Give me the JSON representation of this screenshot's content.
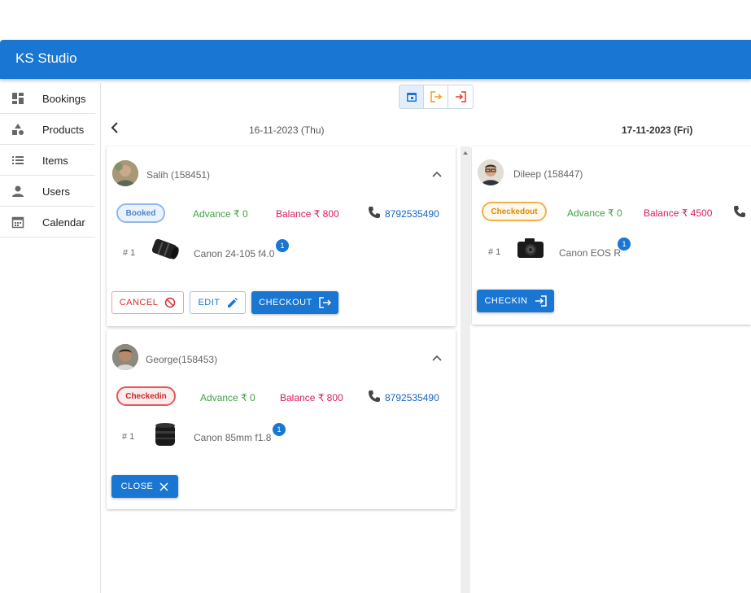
{
  "app": {
    "title": "KS Studio",
    "accent": "#1976d2"
  },
  "sidebar": {
    "items": [
      {
        "label": "Bookings",
        "icon": "dashboard-icon"
      },
      {
        "label": "Products",
        "icon": "category-icon"
      },
      {
        "label": "Items",
        "icon": "list-icon"
      },
      {
        "label": "Users",
        "icon": "person-icon"
      },
      {
        "label": "Calendar",
        "icon": "calendar-icon"
      }
    ]
  },
  "view_toggle": [
    "calendar-icon",
    "logout-icon",
    "login-icon"
  ],
  "dates": [
    "16-11-2023 (Thu)",
    "17-11-2023 (Fri)"
  ],
  "bookings": [
    {
      "customer": "Salih (158451)",
      "status": "Booked",
      "advance": "Advance ₹ 0",
      "balance": "Balance ₹ 800",
      "phone": "8792535490",
      "index": "# 1",
      "product": "Canon 24-105 f4.0",
      "qty": "1",
      "buttons": {
        "cancel": "CANCEL",
        "edit": "EDIT",
        "checkout": "CHECKOUT"
      }
    },
    {
      "customer": "George(158453)",
      "status": "Checkedin",
      "advance": "Advance ₹ 0",
      "balance": "Balance ₹ 800",
      "phone": "8792535490",
      "index": "# 1",
      "product": "Canon 85mm f1.8",
      "qty": "1",
      "buttons": {
        "close": "CLOSE"
      }
    },
    {
      "customer": "Dileep (158447)",
      "status": "Checkedout",
      "advance": "Advance ₹ 0",
      "balance": "Balance ₹ 4500",
      "index": "# 1",
      "product": "Canon EOS R",
      "qty": "1",
      "buttons": {
        "checkin": "CHECKIN"
      }
    }
  ]
}
